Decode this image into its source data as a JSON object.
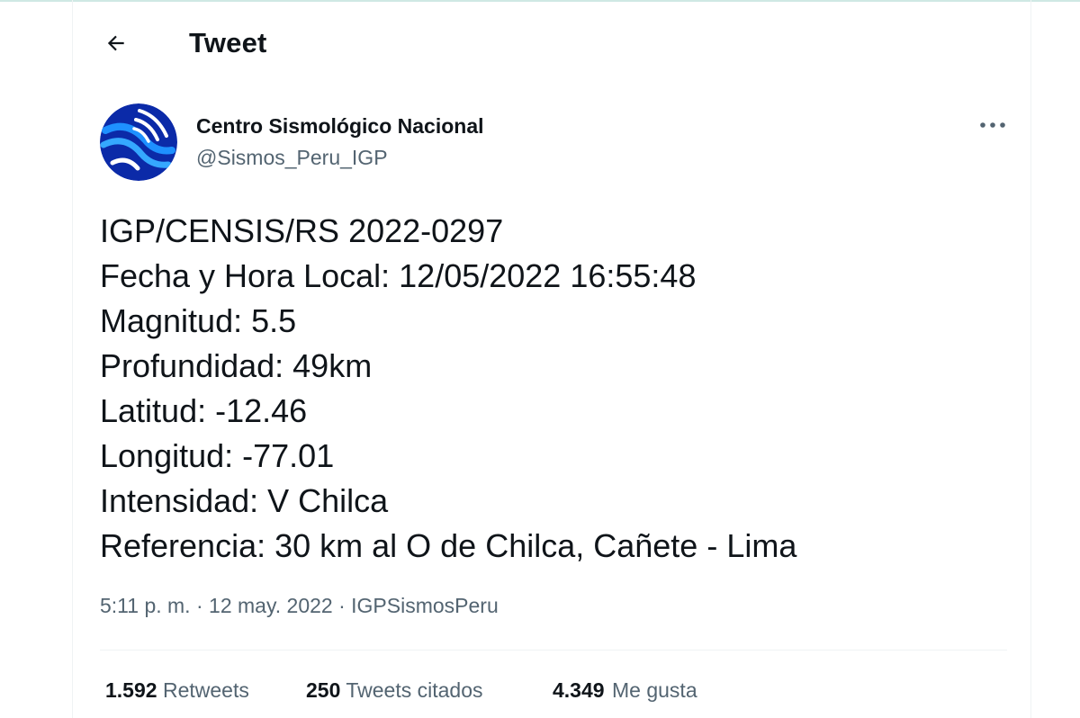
{
  "header": {
    "title": "Tweet"
  },
  "author": {
    "name": "Centro Sismológico Nacional",
    "handle": "@Sismos_Peru_IGP",
    "avatar_colors": [
      "#0b2aa8",
      "#1e90ff",
      "#ffffff"
    ]
  },
  "tweet": {
    "lines": [
      "IGP/CENSIS/RS 2022-0297",
      "Fecha y Hora Local: 12/05/2022 16:55:48",
      "Magnitud: 5.5",
      "Profundidad: 49km",
      "Latitud: -12.46",
      "Longitud: -77.01",
      "Intensidad: V Chilca",
      "Referencia: 30 km al O de Chilca, Cañete - Lima"
    ],
    "time": "5:11 p. m.",
    "sep": "·",
    "date": "12 may. 2022",
    "source": "IGPSismosPeru"
  },
  "stats": {
    "retweets": {
      "count": "1.592",
      "label": "Retweets"
    },
    "quotes": {
      "count": "250",
      "label": "Tweets citados"
    },
    "likes": {
      "count": "4.349",
      "label": "Me gusta"
    }
  },
  "icons": {
    "back": "arrow-left-icon",
    "more": "more-horizontal-icon"
  },
  "colors": {
    "text_primary": "#0f1419",
    "text_secondary": "#536471",
    "divider": "#eff3f4"
  }
}
